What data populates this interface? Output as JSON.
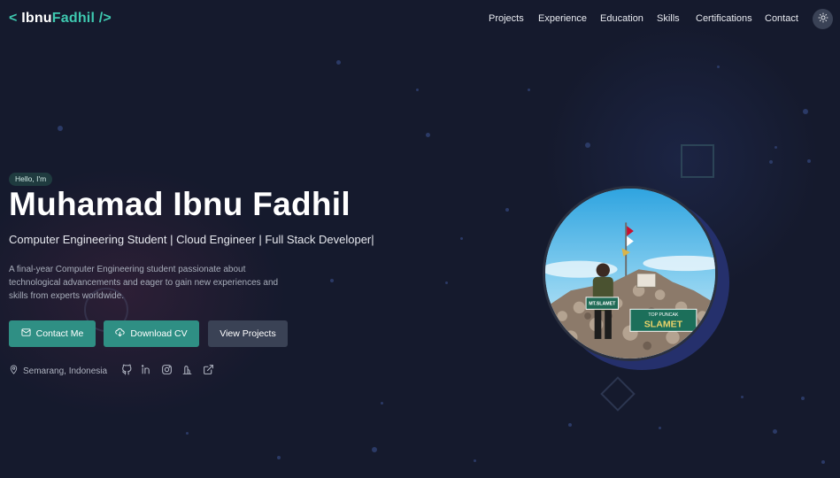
{
  "logo": {
    "open": "< ",
    "first": "Ibnu",
    "last": "Fadhil",
    "close": " />"
  },
  "nav": [
    {
      "label": "Projects"
    },
    {
      "label": "Experience"
    },
    {
      "label": "Education"
    },
    {
      "label": "Skills"
    },
    {
      "label": "Certifications"
    },
    {
      "label": "Contact"
    }
  ],
  "theme_toggle_icon": "sun-icon",
  "hero": {
    "greeting": "Hello, I'm",
    "name": "Muhamad Ibnu Fadhil",
    "role": "Computer Engineering Student | Cloud Engineer | Full Stack Developer|",
    "description": "A final-year Computer Engineering student passionate about technological advancements and eager to gain new experiences and skills from experts worldwide.",
    "buttons": {
      "contact": {
        "label": "Contact Me",
        "icon": "mail-icon"
      },
      "cv": {
        "label": "Download CV",
        "icon": "cloud-download-icon"
      },
      "projects": {
        "label": "View Projects"
      }
    },
    "location": "Semarang, Indonesia",
    "social_icons": [
      "github-icon",
      "linkedin-icon",
      "instagram-icon",
      "threads-icon",
      "external-link-icon"
    ]
  },
  "profile_photo": {
    "sign_top": "MT.SLAMET",
    "banner_top": "TOP PUNCAK",
    "banner_main": "SLAMET"
  },
  "colors": {
    "accent": "#3ec9b0",
    "button_primary": "#2f8f84",
    "button_secondary": "#3a4255",
    "background": "#151a2d"
  }
}
